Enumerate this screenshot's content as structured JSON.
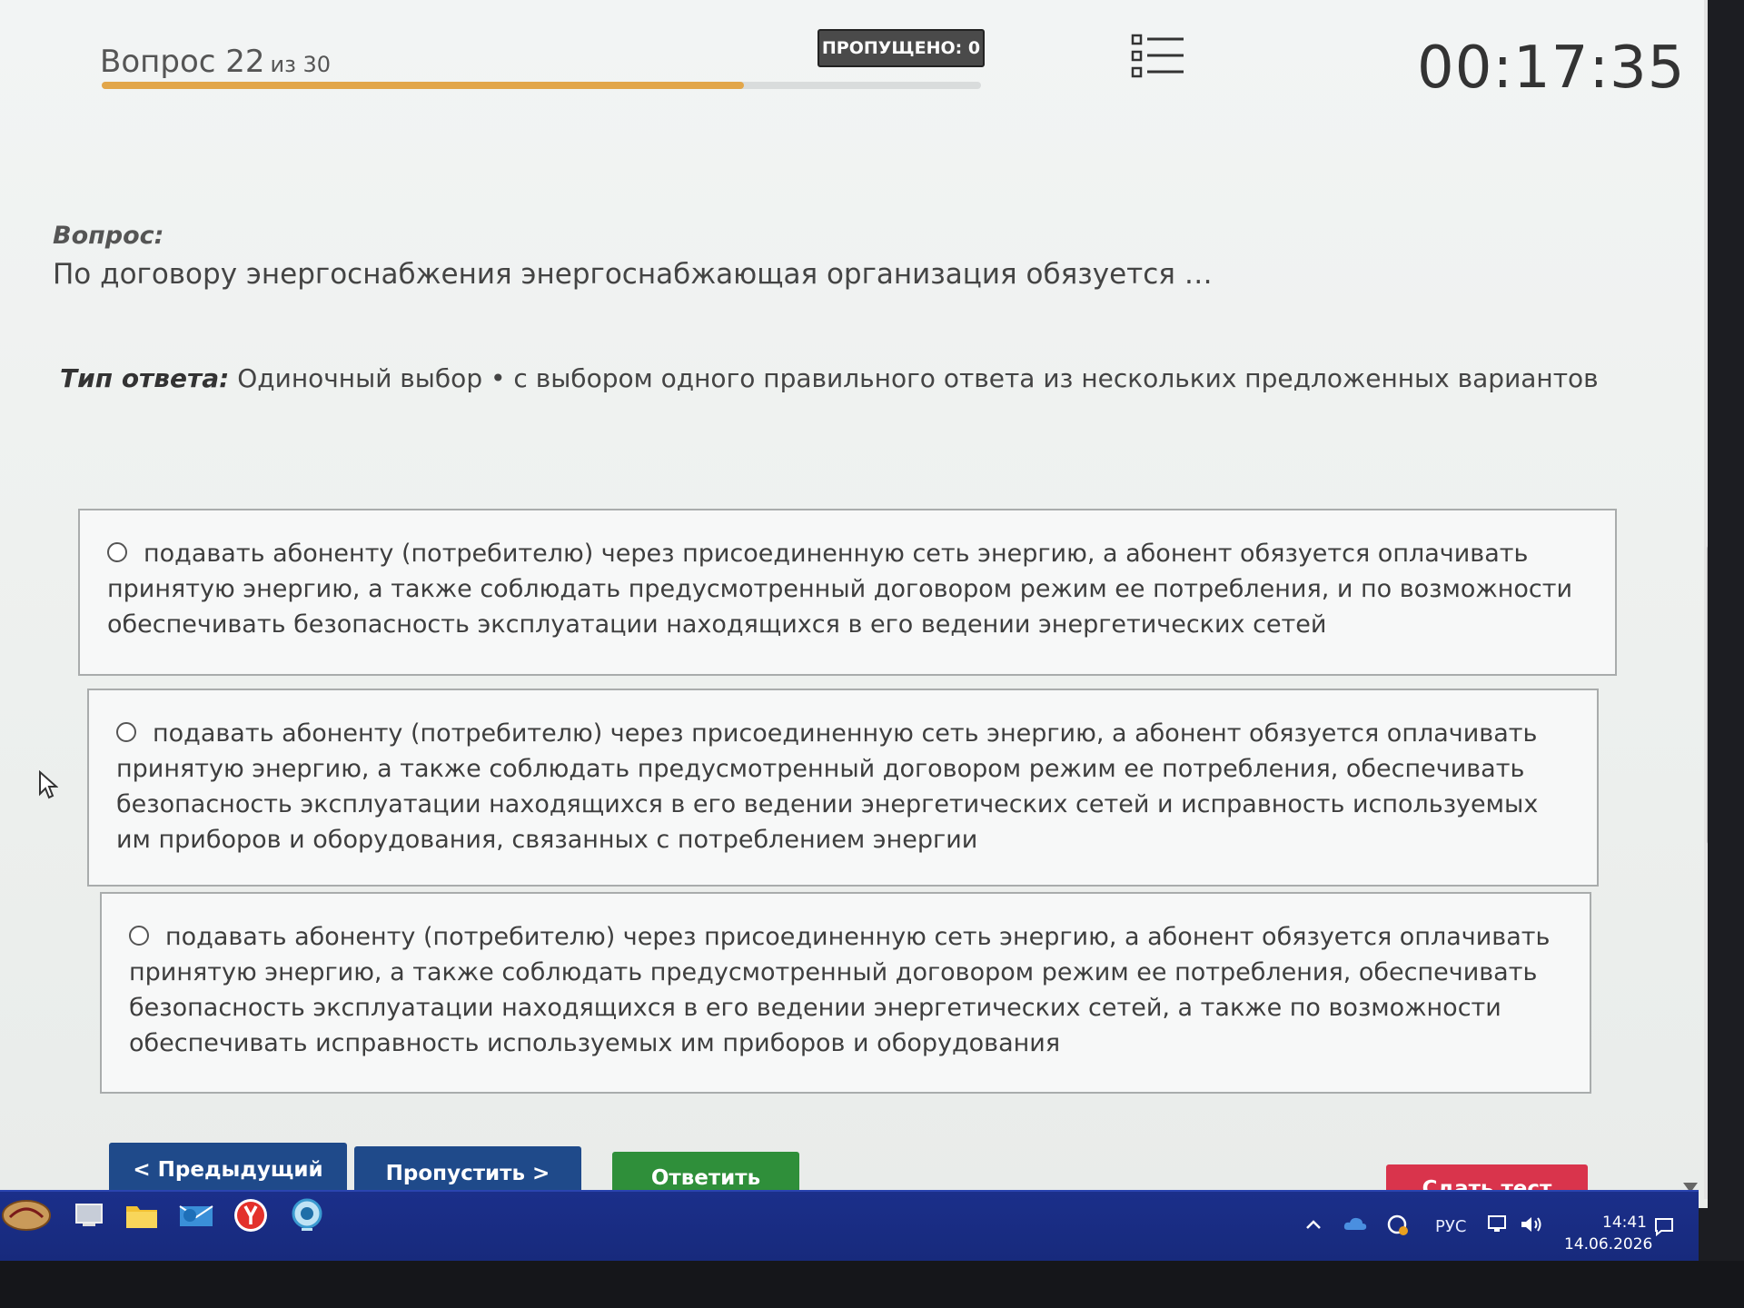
{
  "header": {
    "question_word": "Вопрос",
    "question_number": "22",
    "of_total": "из 30",
    "progress_fraction": 0.73,
    "skipped_label": "ПРОПУЩЕНО: 0",
    "timer": "00:17:35"
  },
  "question": {
    "label": "Вопрос:",
    "text": "По договору энергоснабжения энергоснабжающая организация обязуется …",
    "answer_type_label": "Тип ответа:",
    "answer_type_value": "Одиночный выбор • с выбором одного правильного ответа из нескольких предложенных вариантов"
  },
  "options": [
    "подавать абоненту (потребителю) через присоединенную сеть энергию, а абонент обязуется оплачивать принятую энергию, а также соблюдать предусмотренный договором режим ее потребления, и по возможности обеспечивать безопасность эксплуатации находящихся в его ведении энергетических сетей",
    "подавать абоненту (потребителю) через присоединенную сеть энергию, а абонент обязуется оплачивать принятую энергию, а также соблюдать предусмотренный договором режим ее потребления, обеспечивать безопасность эксплуатации находящихся в его ведении энергетических сетей и исправность используемых им приборов и оборудования, связанных с потреблением энергии",
    "подавать абоненту (потребителю) через присоединенную сеть энергию, а абонент обязуется оплачивать принятую энергию, а также соблюдать предусмотренный договором режим ее потребления, обеспечивать безопасность эксплуатации находящихся в его ведении энергетических сетей, а также по возможности обеспечивать исправность используемых им приборов и оборудования"
  ],
  "buttons": {
    "prev": "< Предыдущий",
    "skip": "Пропустить >",
    "answer": "Ответить",
    "submit": "Сдать тест"
  },
  "taskbar": {
    "language": "РУС",
    "time": "14:41",
    "date": "14.06.2026",
    "icons": [
      "start-logo-icon",
      "desktop-icon",
      "file-explorer-icon",
      "mail-icon",
      "yandex-browser-icon",
      "webcam-app-icon"
    ]
  },
  "colors": {
    "progress": "#e2a64a",
    "nav_button": "#1f4a8a",
    "answer_button": "#2f8f3a",
    "submit_button": "#d9344c",
    "taskbar": "#1b2f8a"
  }
}
